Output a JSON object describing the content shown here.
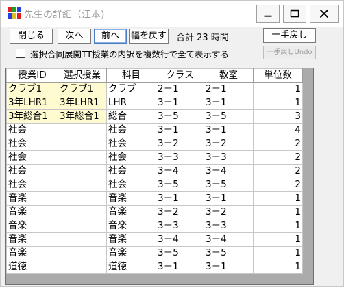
{
  "window": {
    "title": "先生の詳細（江本)"
  },
  "toolbar": {
    "close_label": "閉じる",
    "next_label": "次へ",
    "prev_label": "前へ",
    "reset_width_label": "幅を戻す",
    "total_text": "合計 23 時間",
    "undo_label": "一手戻し",
    "undo_disabled_label": "一手戻しUndo",
    "checkbox_label": "選択合同展開TT授業の内訳を複数行で全て表示する",
    "checkbox_checked": false
  },
  "grid": {
    "columns": [
      "授業ID",
      "選択授業",
      "科目",
      "クラス",
      "教室",
      "単位数"
    ],
    "rows": [
      {
        "id": "クラブ1",
        "select": "クラブ1",
        "subject": "クラブ",
        "class": "2－1",
        "room": "2－1",
        "units": "1",
        "highlight": true
      },
      {
        "id": "3年LHR1",
        "select": "3年LHR1",
        "subject": "LHR",
        "class": "3－1",
        "room": "3－1",
        "units": "1",
        "highlight": true
      },
      {
        "id": "3年総合1",
        "select": "3年総合1",
        "subject": "総合",
        "class": "3－5",
        "room": "3－5",
        "units": "3",
        "highlight": true
      },
      {
        "id": "社会",
        "select": "",
        "subject": "社会",
        "class": "3－1",
        "room": "3－1",
        "units": "4",
        "highlight": false
      },
      {
        "id": "社会",
        "select": "",
        "subject": "社会",
        "class": "3－2",
        "room": "3－2",
        "units": "2",
        "highlight": false
      },
      {
        "id": "社会",
        "select": "",
        "subject": "社会",
        "class": "3－3",
        "room": "3－3",
        "units": "2",
        "highlight": false
      },
      {
        "id": "社会",
        "select": "",
        "subject": "社会",
        "class": "3－4",
        "room": "3－4",
        "units": "2",
        "highlight": false
      },
      {
        "id": "社会",
        "select": "",
        "subject": "社会",
        "class": "3－5",
        "room": "3－5",
        "units": "2",
        "highlight": false
      },
      {
        "id": "音楽",
        "select": "",
        "subject": "音楽",
        "class": "3－1",
        "room": "3－1",
        "units": "1",
        "highlight": false
      },
      {
        "id": "音楽",
        "select": "",
        "subject": "音楽",
        "class": "3－2",
        "room": "3－2",
        "units": "1",
        "highlight": false
      },
      {
        "id": "音楽",
        "select": "",
        "subject": "音楽",
        "class": "3－3",
        "room": "3－3",
        "units": "1",
        "highlight": false
      },
      {
        "id": "音楽",
        "select": "",
        "subject": "音楽",
        "class": "3－4",
        "room": "3－4",
        "units": "1",
        "highlight": false
      },
      {
        "id": "音楽",
        "select": "",
        "subject": "音楽",
        "class": "3－5",
        "room": "3－5",
        "units": "1",
        "highlight": false
      },
      {
        "id": "道徳",
        "select": "",
        "subject": "道徳",
        "class": "3－1",
        "room": "3－1",
        "units": "1",
        "highlight": false
      }
    ]
  },
  "colors": {
    "highlight": "#fffbd0",
    "grid_background": "#ababab",
    "accent": "#4a7cc4"
  }
}
